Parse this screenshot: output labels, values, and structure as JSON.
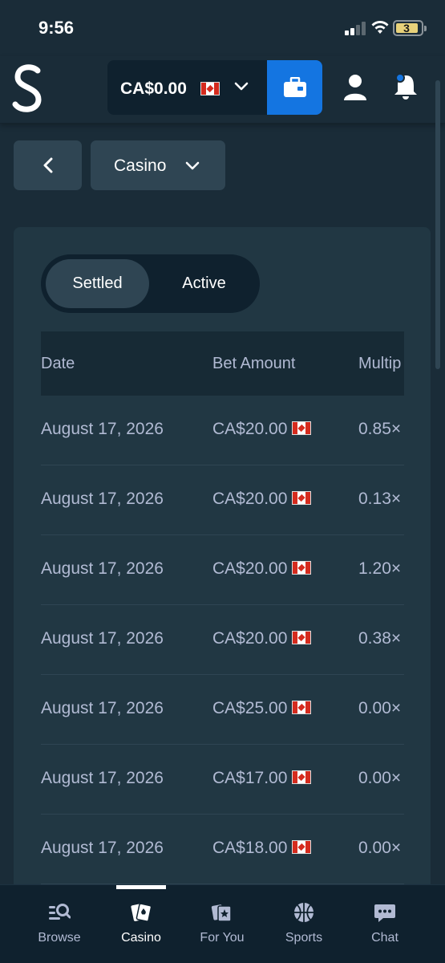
{
  "status_bar": {
    "time": "9:56",
    "battery_level": "3"
  },
  "header": {
    "balance": "CA$0.00",
    "balance_flag": "canada-flag-icon",
    "wallet_icon": "wallet-icon",
    "user_icon": "user-icon",
    "bell_icon": "bell-icon",
    "accent_color": "#1475e1"
  },
  "filters": {
    "back_icon": "chevron-left-icon",
    "category": "Casino"
  },
  "tabs": [
    {
      "label": "Settled",
      "selected": true
    },
    {
      "label": "Active",
      "selected": false
    }
  ],
  "table": {
    "columns": [
      "Date",
      "Bet Amount",
      "Multip"
    ],
    "rows": [
      {
        "date": "August 17, 2026",
        "bet_amount": "CA$20.00",
        "multiplier": "0.85×"
      },
      {
        "date": "August 17, 2026",
        "bet_amount": "CA$20.00",
        "multiplier": "0.13×"
      },
      {
        "date": "August 17, 2026",
        "bet_amount": "CA$20.00",
        "multiplier": "1.20×"
      },
      {
        "date": "August 17, 2026",
        "bet_amount": "CA$20.00",
        "multiplier": "0.38×"
      },
      {
        "date": "August 17, 2026",
        "bet_amount": "CA$25.00",
        "multiplier": "0.00×"
      },
      {
        "date": "August 17, 2026",
        "bet_amount": "CA$17.00",
        "multiplier": "0.00×"
      },
      {
        "date": "August 17, 2026",
        "bet_amount": "CA$18.00",
        "multiplier": "0.00×"
      }
    ]
  },
  "bottom_nav": [
    {
      "label": "Browse",
      "icon": "browse-icon",
      "active": false
    },
    {
      "label": "Casino",
      "icon": "casino-cards-icon",
      "active": true
    },
    {
      "label": "For You",
      "icon": "for-you-icon",
      "active": false
    },
    {
      "label": "Sports",
      "icon": "basketball-icon",
      "active": false
    },
    {
      "label": "Chat",
      "icon": "chat-icon",
      "active": false
    }
  ]
}
